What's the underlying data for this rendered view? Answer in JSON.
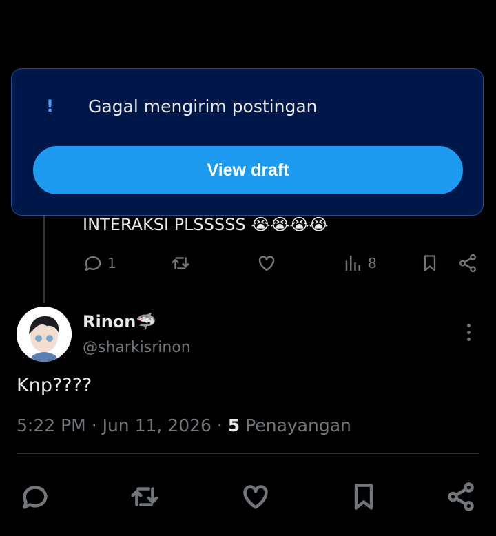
{
  "toast": {
    "icon": "!",
    "message": "Gagal mengirim postingan",
    "button_label": "View draft"
  },
  "parent_tweet": {
    "text": "INTERAKSI PLSSSSS",
    "emoji": "😭😭😭😭",
    "reply_count": "1",
    "views_count": "8"
  },
  "tweet": {
    "display_name": "Rinon",
    "name_emoji": "🦈",
    "handle": "@sharkisrinon",
    "text": "Knp????",
    "time": "5:22 PM",
    "date": "Jun 11, 2026",
    "views": "5",
    "views_label": "Penayangan"
  },
  "colors": {
    "background": "#000000",
    "toast_bg": "#00174a",
    "accent": "#1d9bf0",
    "muted": "#71767b"
  },
  "icons": [
    "reply-icon",
    "retweet-icon",
    "like-icon",
    "views-icon",
    "bookmark-icon",
    "share-icon",
    "more-icon",
    "alert-icon"
  ]
}
